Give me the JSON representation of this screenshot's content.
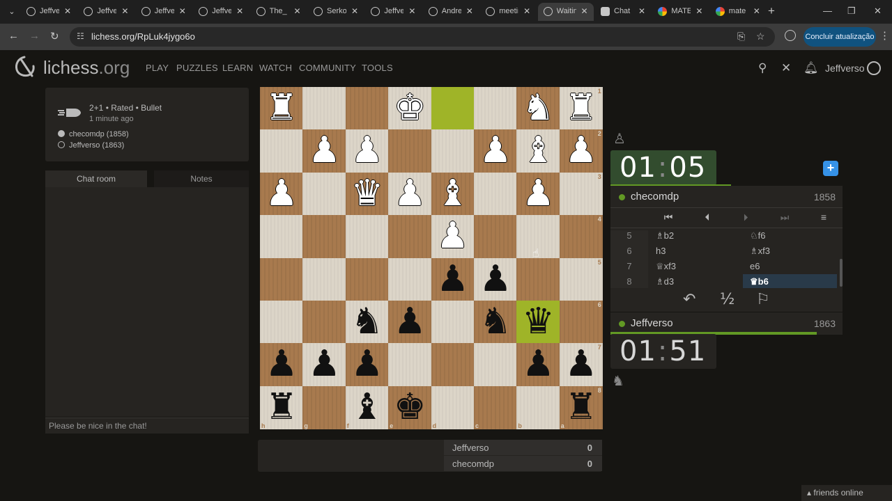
{
  "browser": {
    "tabs": [
      {
        "title": "Jeffverso",
        "favicon": "lichess-icon",
        "active": false
      },
      {
        "title": "Jeffverso",
        "favicon": "lichess-icon",
        "active": false
      },
      {
        "title": "Jeffverso",
        "favicon": "lichess-icon",
        "active": false
      },
      {
        "title": "Jeffverso",
        "favicon": "lichess-icon",
        "active": false
      },
      {
        "title": "The_",
        "favicon": "lichess-icon",
        "active": false
      },
      {
        "title": "Serko",
        "favicon": "lichess-icon",
        "active": false
      },
      {
        "title": "Jeffverso",
        "favicon": "lichess-icon",
        "active": false
      },
      {
        "title": "Andre",
        "favicon": "lichess-icon",
        "active": false
      },
      {
        "title": "meeting",
        "favicon": "lichess-icon",
        "active": false
      },
      {
        "title": "Waiting",
        "favicon": "lichess-icon",
        "active": true
      },
      {
        "title": "Chat",
        "favicon": "chat-icon",
        "active": false
      },
      {
        "title": "MATE",
        "favicon": "google-icon",
        "active": false
      },
      {
        "title": "mate",
        "favicon": "google-icon",
        "active": false
      }
    ],
    "url": "lichess.org/RpLuk4jygo6o",
    "update_button": "Concluir atualização"
  },
  "header": {
    "brand": "lichess",
    "brand_tld": ".org",
    "nav": [
      "PLAY",
      "PUZZLES",
      "LEARN",
      "WATCH",
      "COMMUNITY",
      "TOOLS"
    ],
    "username": "Jeffverso"
  },
  "game": {
    "type": "2+1 • Rated • Bullet",
    "time_ago": "1 minute ago",
    "white_player": "checomdp (1858)",
    "black_player": "Jeffverso (1863)"
  },
  "chat": {
    "tab_chat": "Chat room",
    "tab_notes": "Notes",
    "placeholder": "Please be nice in the chat!"
  },
  "board": {
    "orientation": "black",
    "rank_labels": [
      "1",
      "2",
      "3",
      "4",
      "5",
      "6",
      "7",
      "8"
    ],
    "file_labels": [
      "h",
      "g",
      "f",
      "e",
      "d",
      "c",
      "b",
      "a"
    ],
    "highlight_squares": [
      "b6",
      "d1"
    ],
    "pieces": [
      {
        "square": "h1",
        "piece": "♜",
        "color": "white"
      },
      {
        "square": "e1",
        "piece": "♚",
        "color": "white"
      },
      {
        "square": "b1",
        "piece": "♞",
        "color": "white"
      },
      {
        "square": "a1",
        "piece": "♜",
        "color": "white"
      },
      {
        "square": "g2",
        "piece": "♟",
        "color": "white"
      },
      {
        "square": "f2",
        "piece": "♟",
        "color": "white"
      },
      {
        "square": "c2",
        "piece": "♟",
        "color": "white"
      },
      {
        "square": "b2",
        "piece": "♝",
        "color": "white"
      },
      {
        "square": "a2",
        "piece": "♟",
        "color": "white"
      },
      {
        "square": "h3",
        "piece": "♟",
        "color": "white"
      },
      {
        "square": "f3",
        "piece": "♛",
        "color": "white"
      },
      {
        "square": "e3",
        "piece": "♟",
        "color": "white"
      },
      {
        "square": "d3",
        "piece": "♝",
        "color": "white"
      },
      {
        "square": "b3",
        "piece": "♟",
        "color": "white"
      },
      {
        "square": "d4",
        "piece": "♟",
        "color": "white"
      },
      {
        "square": "d5",
        "piece": "♟",
        "color": "black"
      },
      {
        "square": "c5",
        "piece": "♟",
        "color": "black"
      },
      {
        "square": "f6",
        "piece": "♞",
        "color": "black"
      },
      {
        "square": "e6",
        "piece": "♟",
        "color": "black"
      },
      {
        "square": "c6",
        "piece": "♞",
        "color": "black"
      },
      {
        "square": "b6",
        "piece": "♛",
        "color": "black"
      },
      {
        "square": "h7",
        "piece": "♟",
        "color": "black"
      },
      {
        "square": "g7",
        "piece": "♟",
        "color": "black"
      },
      {
        "square": "f7",
        "piece": "♟",
        "color": "black"
      },
      {
        "square": "b7",
        "piece": "♟",
        "color": "black"
      },
      {
        "square": "a7",
        "piece": "♟",
        "color": "black"
      },
      {
        "square": "h8",
        "piece": "♜",
        "color": "black"
      },
      {
        "square": "f8",
        "piece": "♝",
        "color": "black"
      },
      {
        "square": "e8",
        "piece": "♚",
        "color": "black"
      },
      {
        "square": "a8",
        "piece": "♜",
        "color": "black"
      }
    ]
  },
  "crosstable": [
    {
      "name": "Jeffverso",
      "score": "0"
    },
    {
      "name": "checomdp",
      "score": "0"
    }
  ],
  "opponent": {
    "name": "checomdp",
    "rating": "1858",
    "clock_min": "01",
    "clock_sec": "05",
    "clock_sep": ":",
    "time_left_fraction": 0.52
  },
  "player": {
    "name": "Jeffverso",
    "rating": "1863",
    "clock_min": "01",
    "clock_sec": "51",
    "clock_sep": ":",
    "time_left_fraction": 0.89
  },
  "move_controls": [
    "first-move-icon",
    "prev-move-icon",
    "next-move-icon",
    "last-move-icon",
    "menu-icon"
  ],
  "moves": [
    {
      "no": "5",
      "white": "♗b2",
      "black": "♘f6"
    },
    {
      "no": "6",
      "white": "h3",
      "black": "♗xf3"
    },
    {
      "no": "7",
      "white": "♕xf3",
      "black": "e6"
    },
    {
      "no": "8",
      "white": "♗d3",
      "black": "♛b6"
    }
  ],
  "game_actions": {
    "takeback": "↶",
    "draw": "½",
    "resign": "⚐"
  },
  "friends_online": "friends online",
  "colors": {
    "background": "#161512",
    "panel": "#262421",
    "accent_green": "#629924",
    "highlight": "#9fb428",
    "selected_move": "#293a49"
  }
}
